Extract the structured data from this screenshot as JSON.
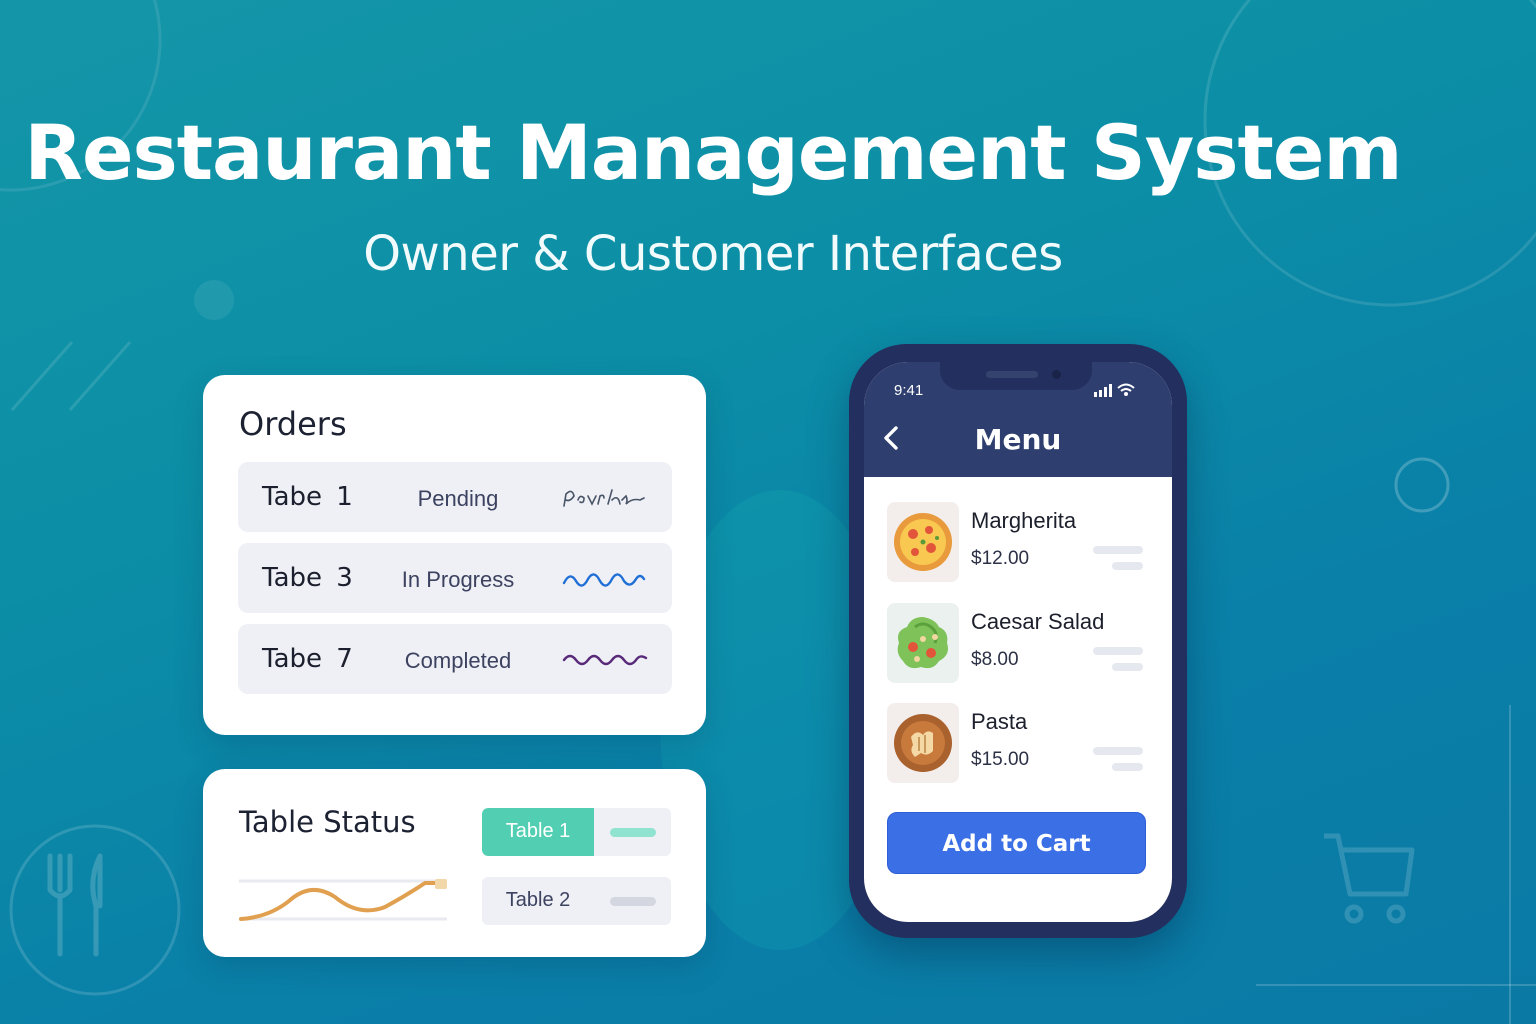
{
  "page": {
    "title": "Restaurant Management System",
    "subtitle": "Owner & Customer Interfaces"
  },
  "orders": {
    "title": "Orders",
    "rows": [
      {
        "table": "Tabe 1",
        "status": "Pending",
        "signature_color": "#4a5468"
      },
      {
        "table": "Tabe 3",
        "status": "In Progress",
        "signature_color": "#1f6fd6"
      },
      {
        "table": "Tabe 7",
        "status": "Completed",
        "signature_color": "#5a2a7a"
      }
    ]
  },
  "table_status": {
    "title": "Table Status",
    "tables": [
      {
        "label": "Table 1",
        "state": "active",
        "color": "#52cfb2"
      },
      {
        "label": "Table 2",
        "state": "inactive",
        "color": "#d4d7e0"
      }
    ]
  },
  "phone": {
    "time": "9:41",
    "screen_title": "Menu",
    "items": [
      {
        "name": "Margherita",
        "price": "$12.00",
        "icon": "pizza-icon"
      },
      {
        "name": "Caesar Salad",
        "price": "$8.00",
        "icon": "salad-icon"
      },
      {
        "name": "Pasta",
        "price": "$15.00",
        "icon": "pasta-icon"
      }
    ],
    "cart_button": "Add to Cart"
  },
  "colors": {
    "background": "#0c8fa6",
    "phone_frame": "#232f5e",
    "header": "#2e3e6e",
    "accent_button": "#3b6fe6",
    "active_table": "#52cfb2"
  }
}
